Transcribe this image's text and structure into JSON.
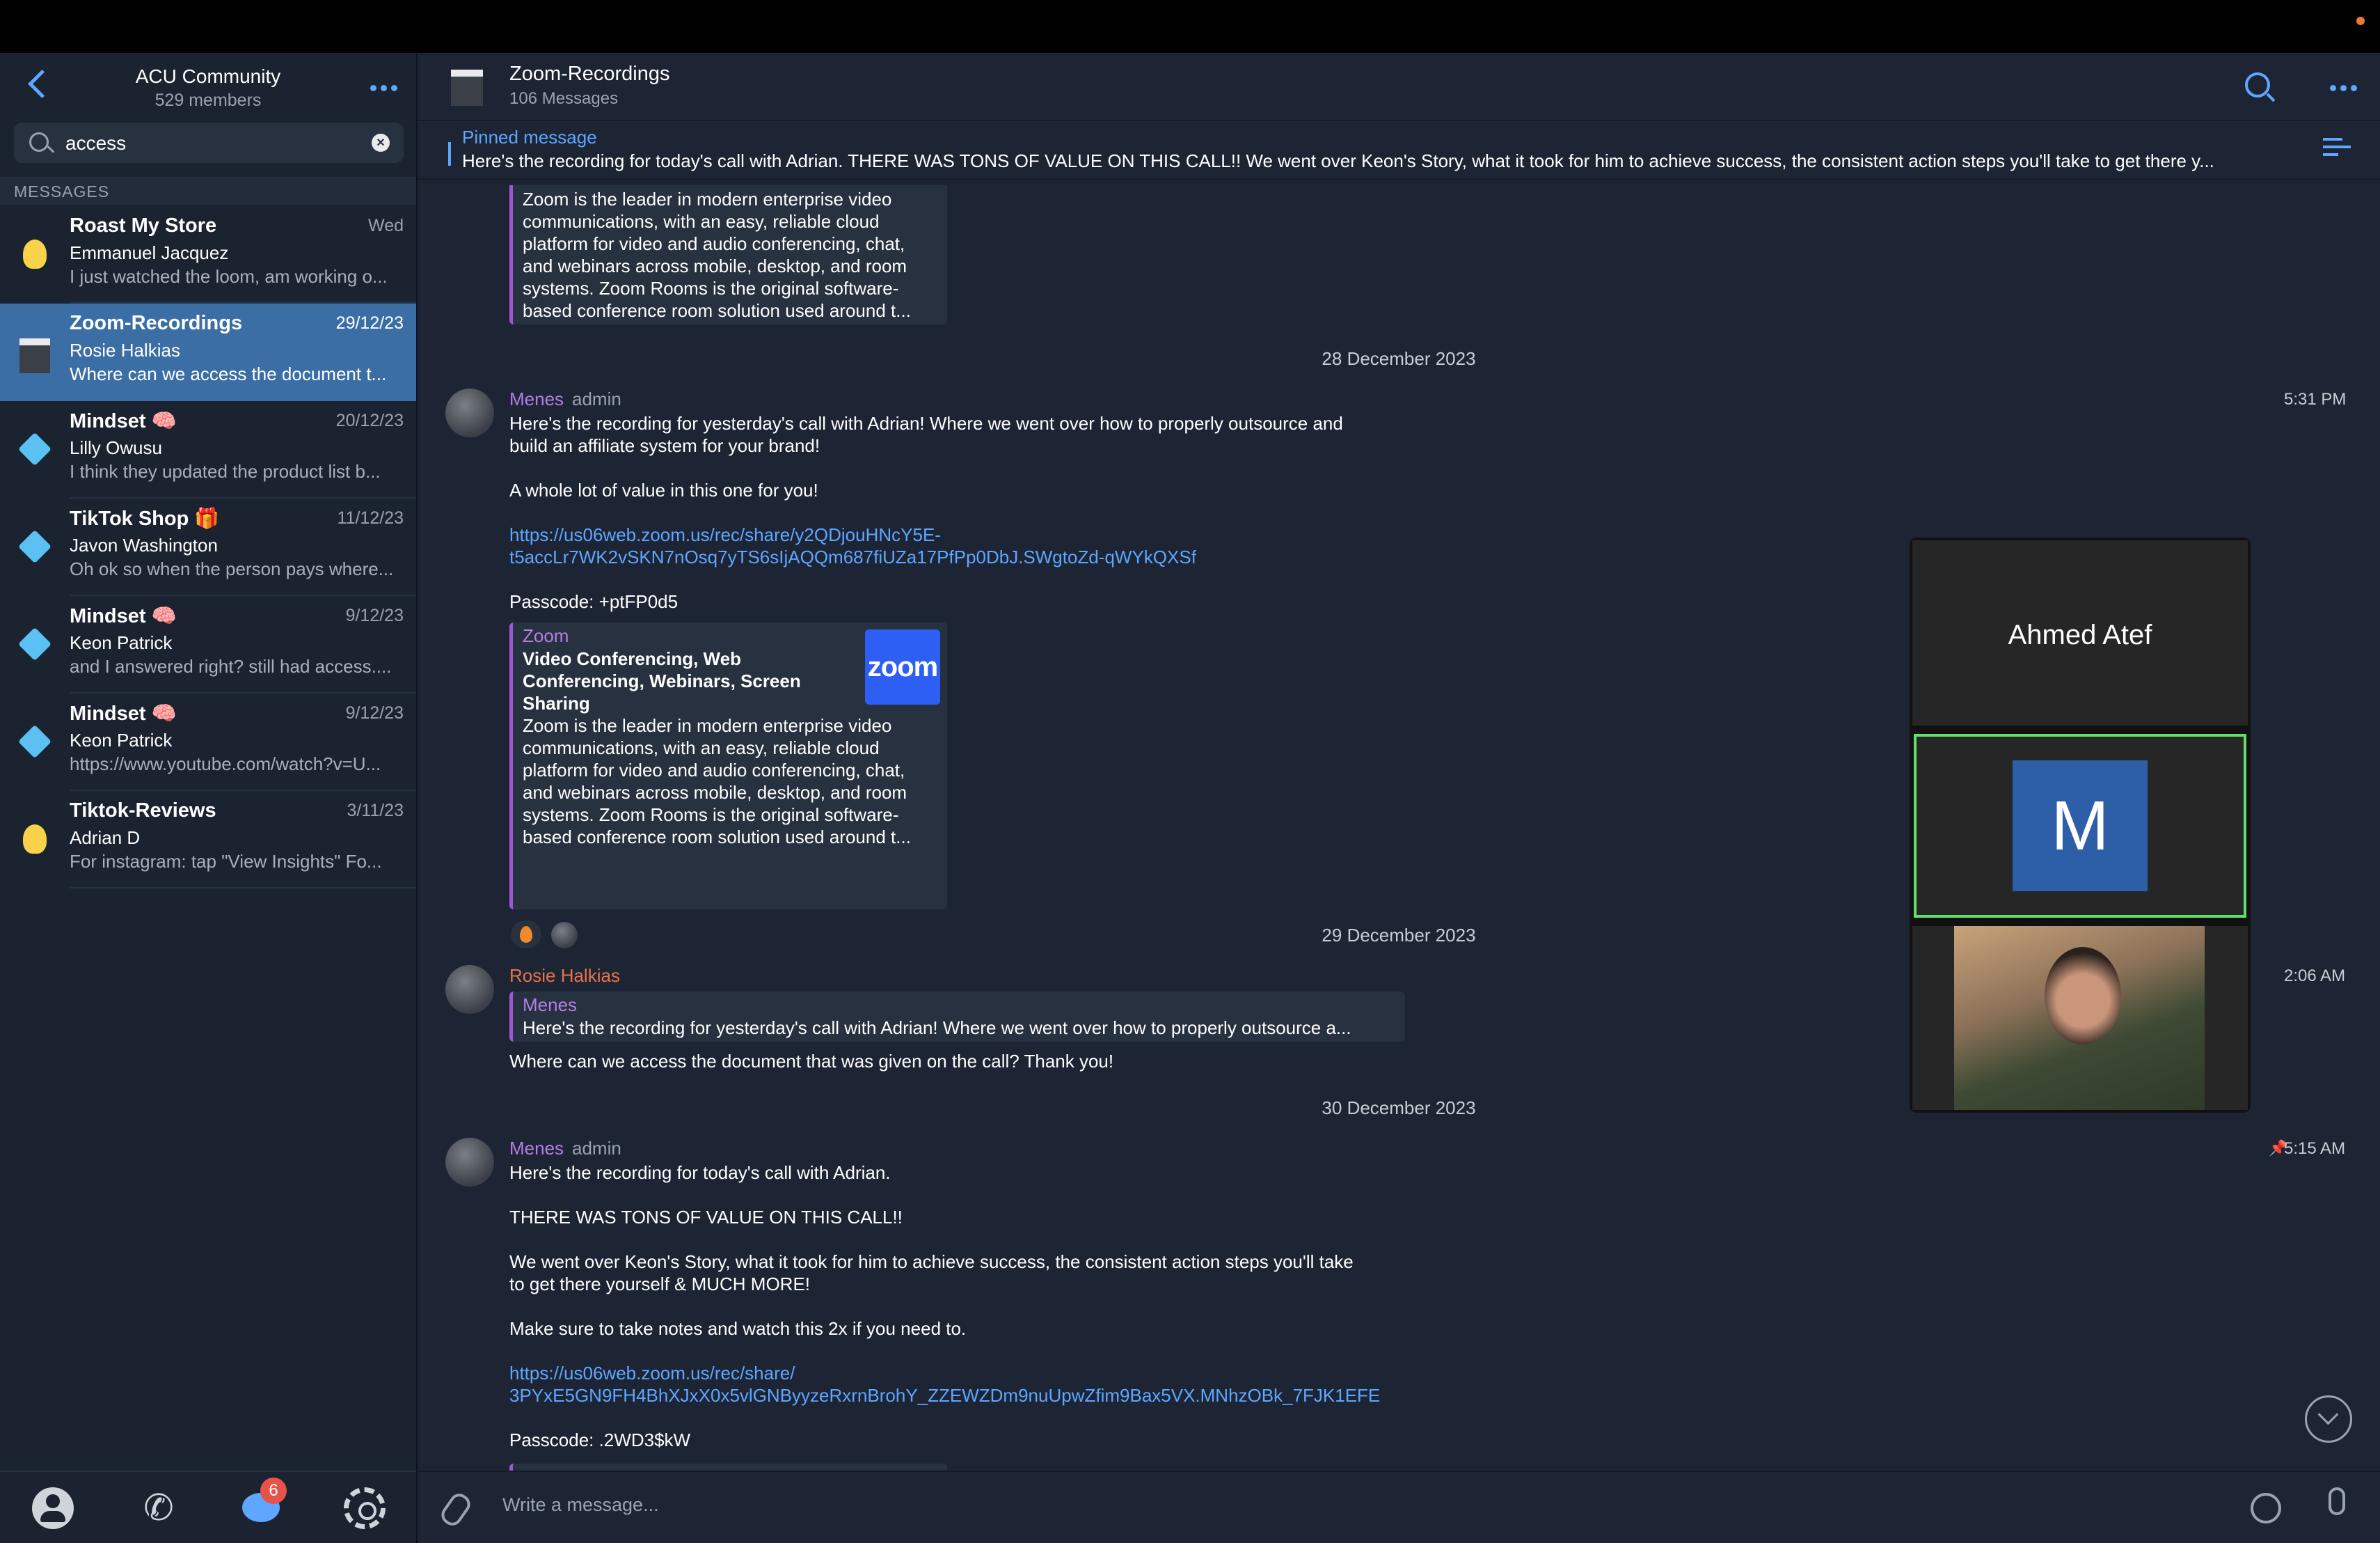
{
  "sidebar": {
    "group_name": "ACU Community",
    "group_members": "529 members",
    "search_value": "access",
    "section_label": "MESSAGES",
    "items": [
      {
        "title": "Roast My Store",
        "date": "Wed",
        "author": "Emmanuel Jacquez",
        "preview": "I just watched the loom, am working o...",
        "icon": "bulb-icon"
      },
      {
        "title": "Zoom-Recordings",
        "date": "29/12/23",
        "author": "Rosie Halkias",
        "preview": "Where can we access the document t...",
        "icon": "clapperboard-icon"
      },
      {
        "title": "Mindset 🧠",
        "date": "20/12/23",
        "author": "Lilly Owusu",
        "preview": "I think they updated the product list b...",
        "icon": "diamond-icon"
      },
      {
        "title": "TikTok Shop 🎁",
        "date": "11/12/23",
        "author": "Javon Washington",
        "preview": "Oh ok so when the person pays where...",
        "icon": "diamond-icon"
      },
      {
        "title": "Mindset 🧠",
        "date": "9/12/23",
        "author": "Keon Patrick",
        "preview": "and I answered right? still had access....",
        "icon": "diamond-icon"
      },
      {
        "title": "Mindset 🧠",
        "date": "9/12/23",
        "author": "Keon Patrick",
        "preview": "https://www.youtube.com/watch?v=U...",
        "icon": "diamond-icon"
      },
      {
        "title": "Tiktok-Reviews",
        "date": "3/11/23",
        "author": "Adrian D",
        "preview": "For instagram: tap \"View Insights\"  Fo...",
        "icon": "bulb-icon"
      }
    ],
    "tabs": {
      "chats_badge": "6"
    }
  },
  "chat": {
    "title": "Zoom-Recordings",
    "count": "106 Messages",
    "pinned_label": "Pinned message",
    "pinned_text": "Here's the recording for today's call with Adrian.   THERE WAS TONS OF VALUE ON THIS CALL!!  We went over Keon's Story, what it took for him to achieve success, the consistent action steps you'll take to get there y..."
  },
  "top_card": {
    "desc": [
      "Zoom is the leader in modern enterprise video",
      "communications, with an easy, reliable cloud",
      "platform for video and audio conferencing, chat,",
      "and webinars across mobile, desktop, and room",
      "systems. Zoom Rooms is the original software-",
      "based conference room solution used around t..."
    ]
  },
  "dates": [
    "28 December 2023",
    "29 December 2023",
    "30 December 2023"
  ],
  "msg1": {
    "sender": "Menes",
    "role": "admin",
    "time": "5:31 PM",
    "line1": "Here's the recording for yesterday's call with Adrian! Where we went over how to properly outsource and",
    "line2": "build an affiliate system for your brand!",
    "line3": "A whole lot of value in this one for you!",
    "link1": "https://us06web.zoom.us/rec/share/y2QDjouHNcY5E-",
    "link2": "t5accLr7WK2vSKN7nOsq7yTS6sIjAQQm687fiUZa17PfPp0DbJ.SWgtoZd-qWYkQXSf",
    "passcode": "Passcode: +ptFP0d5",
    "card_site": "Zoom",
    "card_title": [
      "Video Conferencing, Web",
      "Conferencing, Webinars, Screen",
      "Sharing"
    ],
    "card_logo": "zoom"
  },
  "msg2": {
    "sender": "Rosie Halkias",
    "time": "2:06 AM",
    "reply_sender": "Menes",
    "reply_text": "Here's the recording for yesterday's call with Adrian! Where we went over how to properly outsource a...",
    "text": "Where can we access the document that was given on the call? Thank you!"
  },
  "msg3": {
    "sender": "Menes",
    "role": "admin",
    "time": "5:15 AM",
    "line1": "Here's the recording for today's call with Adrian.",
    "line2": "THERE WAS TONS OF VALUE ON THIS CALL!!",
    "line3": "We went over Keon's Story, what it took for him to achieve success, the consistent action steps you'll take",
    "line4": "to get there yourself & MUCH MORE!",
    "line5": "Make sure to take notes and watch this 2x if you need to.",
    "link1": "https://us06web.zoom.us/rec/share/",
    "link2": "3PYxE5GN9FH4BhXJxX0x5vlGNByyzeRxrnBrohY_ZZEWZDm9nuUpwZfim9Bax5VX.MNhzOBk_7FJK1EFE",
    "passcode": "Passcode: .2WD3$kW"
  },
  "video": {
    "participant_name": "Ahmed Atef",
    "initial": "M"
  },
  "composer": {
    "placeholder": "Write a message..."
  }
}
